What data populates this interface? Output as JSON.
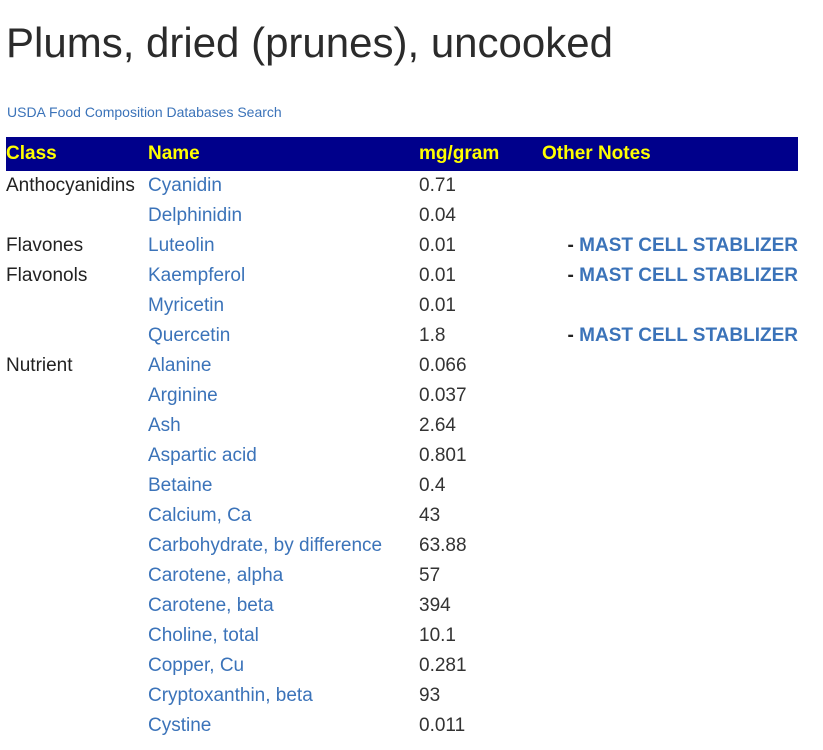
{
  "page": {
    "title": "Plums, dried (prunes), uncooked",
    "search_link": "USDA Food Composition Databases Search"
  },
  "table": {
    "headers": [
      "Class",
      "Name",
      "mg/gram",
      "Other Notes"
    ],
    "rows": [
      {
        "class": "Anthocyanidins",
        "name": "Cyanidin",
        "mg": "0.71",
        "dash": "",
        "note": ""
      },
      {
        "class": "",
        "name": "Delphinidin",
        "mg": "0.04",
        "dash": "",
        "note": ""
      },
      {
        "class": "Flavones",
        "name": "Luteolin",
        "mg": "0.01",
        "dash": "-",
        "note": "MAST CELL STABLIZER"
      },
      {
        "class": "Flavonols",
        "name": "Kaempferol",
        "mg": "0.01",
        "dash": "-",
        "note": "MAST CELL STABLIZER"
      },
      {
        "class": "",
        "name": "Myricetin",
        "mg": "0.01",
        "dash": "",
        "note": ""
      },
      {
        "class": "",
        "name": "Quercetin",
        "mg": "1.8",
        "dash": "-",
        "note": "MAST CELL STABLIZER"
      },
      {
        "class": "Nutrient",
        "name": "Alanine",
        "mg": "0.066",
        "dash": "",
        "note": ""
      },
      {
        "class": "",
        "name": "Arginine",
        "mg": "0.037",
        "dash": "",
        "note": ""
      },
      {
        "class": "",
        "name": "Ash",
        "mg": "2.64",
        "dash": "",
        "note": ""
      },
      {
        "class": "",
        "name": "Aspartic acid",
        "mg": "0.801",
        "dash": "",
        "note": ""
      },
      {
        "class": "",
        "name": "Betaine",
        "mg": "0.4",
        "dash": "",
        "note": ""
      },
      {
        "class": "",
        "name": "Calcium, Ca",
        "mg": "43",
        "dash": "",
        "note": ""
      },
      {
        "class": "",
        "name": "Carbohydrate, by difference",
        "mg": "63.88",
        "dash": "",
        "note": ""
      },
      {
        "class": "",
        "name": "Carotene, alpha",
        "mg": "57",
        "dash": "",
        "note": ""
      },
      {
        "class": "",
        "name": "Carotene, beta",
        "mg": "394",
        "dash": "",
        "note": ""
      },
      {
        "class": "",
        "name": "Choline, total",
        "mg": "10.1",
        "dash": "",
        "note": ""
      },
      {
        "class": "",
        "name": "Copper, Cu",
        "mg": "0.281",
        "dash": "",
        "note": ""
      },
      {
        "class": "",
        "name": "Cryptoxanthin, beta",
        "mg": "93",
        "dash": "",
        "note": ""
      },
      {
        "class": "",
        "name": "Cystine",
        "mg": "0.011",
        "dash": "",
        "note": ""
      }
    ]
  },
  "colors": {
    "header_bg": "#00008b",
    "header_text": "#ffff00",
    "link": "#3b73b9"
  }
}
